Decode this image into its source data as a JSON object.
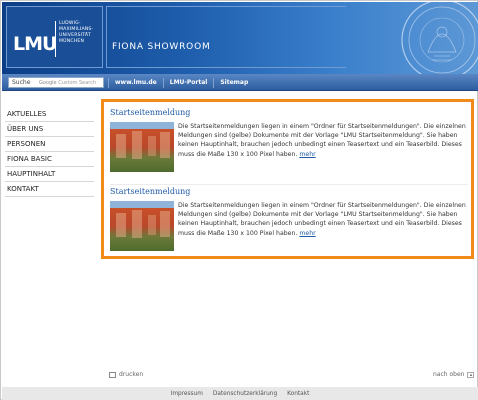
{
  "header": {
    "logo_mark": "LMU",
    "logo_lines": [
      "LUDWIG-",
      "MAXIMILIANS-",
      "UNIVERSITÄT",
      "MÜNCHEN"
    ],
    "site_title": "FIONA SHOWROOM"
  },
  "search": {
    "label": "Suche",
    "placeholder_brand": "Google",
    "placeholder_text": "Custom Search"
  },
  "nav": {
    "links": [
      "www.lmu.de",
      "LMU-Portal",
      "Sitemap"
    ]
  },
  "sidebar": {
    "items": [
      "AKTUELLES",
      "ÜBER UNS",
      "PERSONEN",
      "FIONA BASIC",
      "HAUPTINHALT",
      "KONTAKT"
    ]
  },
  "teasers": [
    {
      "title": "Startseitenmeldung",
      "text": "Die Startseitenmeldungen liegen in einem \"Ordner für Startseitenmeldungen\". Die einzelnen Meldungen sind (gelbe) Dokumente mit der Vorlage \"LMU Startseitenmeldung\". Sie haben keinen Hauptinhalt, brauchen jedoch unbedingt einen Teasertext und ein Teaserbild. Dieses muss die Maße 130 x 100 Pixel haben.",
      "more": "mehr"
    },
    {
      "title": "Startseitenmeldung",
      "text": "Die Startseitenmeldungen liegen in einem \"Ordner für Startseitenmeldungen\". Die einzelnen Meldungen sind (gelbe) Dokumente mit der Vorlage \"LMU Startseitenmeldung\". Sie haben keinen Hauptinhalt, brauchen jedoch unbedingt einen Teasertext und ein Teaserbild. Dieses muss die Maße 130 x 100 Pixel haben.",
      "more": "mehr"
    }
  ],
  "page_tools": {
    "print": "drucken",
    "to_top": "nach oben"
  },
  "footer": {
    "links": [
      "Impressum",
      "Datenschutzerklärung",
      "Kontakt"
    ]
  },
  "colors": {
    "header_blue": "#1f5fae",
    "highlight_orange": "#f28a1a",
    "link_blue": "#1f5aa6"
  }
}
